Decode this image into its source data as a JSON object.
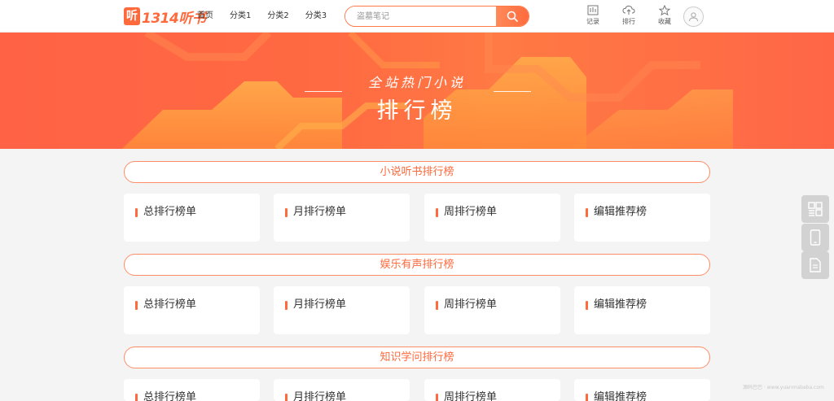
{
  "header": {
    "logo_icon_text": "听",
    "logo_text": "1314听书",
    "nav": [
      "首页",
      "分类1",
      "分类2",
      "分类3"
    ],
    "search_placeholder": "盗墓笔记",
    "tools": [
      {
        "label": "记录",
        "icon": "history-icon"
      },
      {
        "label": "排行",
        "icon": "rank-upload-icon"
      },
      {
        "label": "收藏",
        "icon": "star-icon"
      }
    ]
  },
  "banner": {
    "subtitle": "全站热门小说",
    "title": "排行榜"
  },
  "sections": [
    {
      "title": "小说听书排行榜",
      "cards": [
        "总排行榜单",
        "月排行榜单",
        "周排行榜单",
        "编辑推荐榜"
      ]
    },
    {
      "title": "娱乐有声排行榜",
      "cards": [
        "总排行榜单",
        "月排行榜单",
        "周排行榜单",
        "编辑推荐榜"
      ]
    },
    {
      "title": "知识学问排行榜",
      "cards": [
        "总排行榜单",
        "月排行榜单",
        "周排行榜单",
        "编辑推荐榜"
      ]
    }
  ],
  "floating": [
    "qrcode-icon",
    "mobile-icon",
    "document-icon"
  ],
  "watermark": "源码巴巴 · www.yuanmababa.com",
  "colors": {
    "accent": "#ff6a3d",
    "banner": "#ff6646",
    "background": "#f4f4f4"
  }
}
